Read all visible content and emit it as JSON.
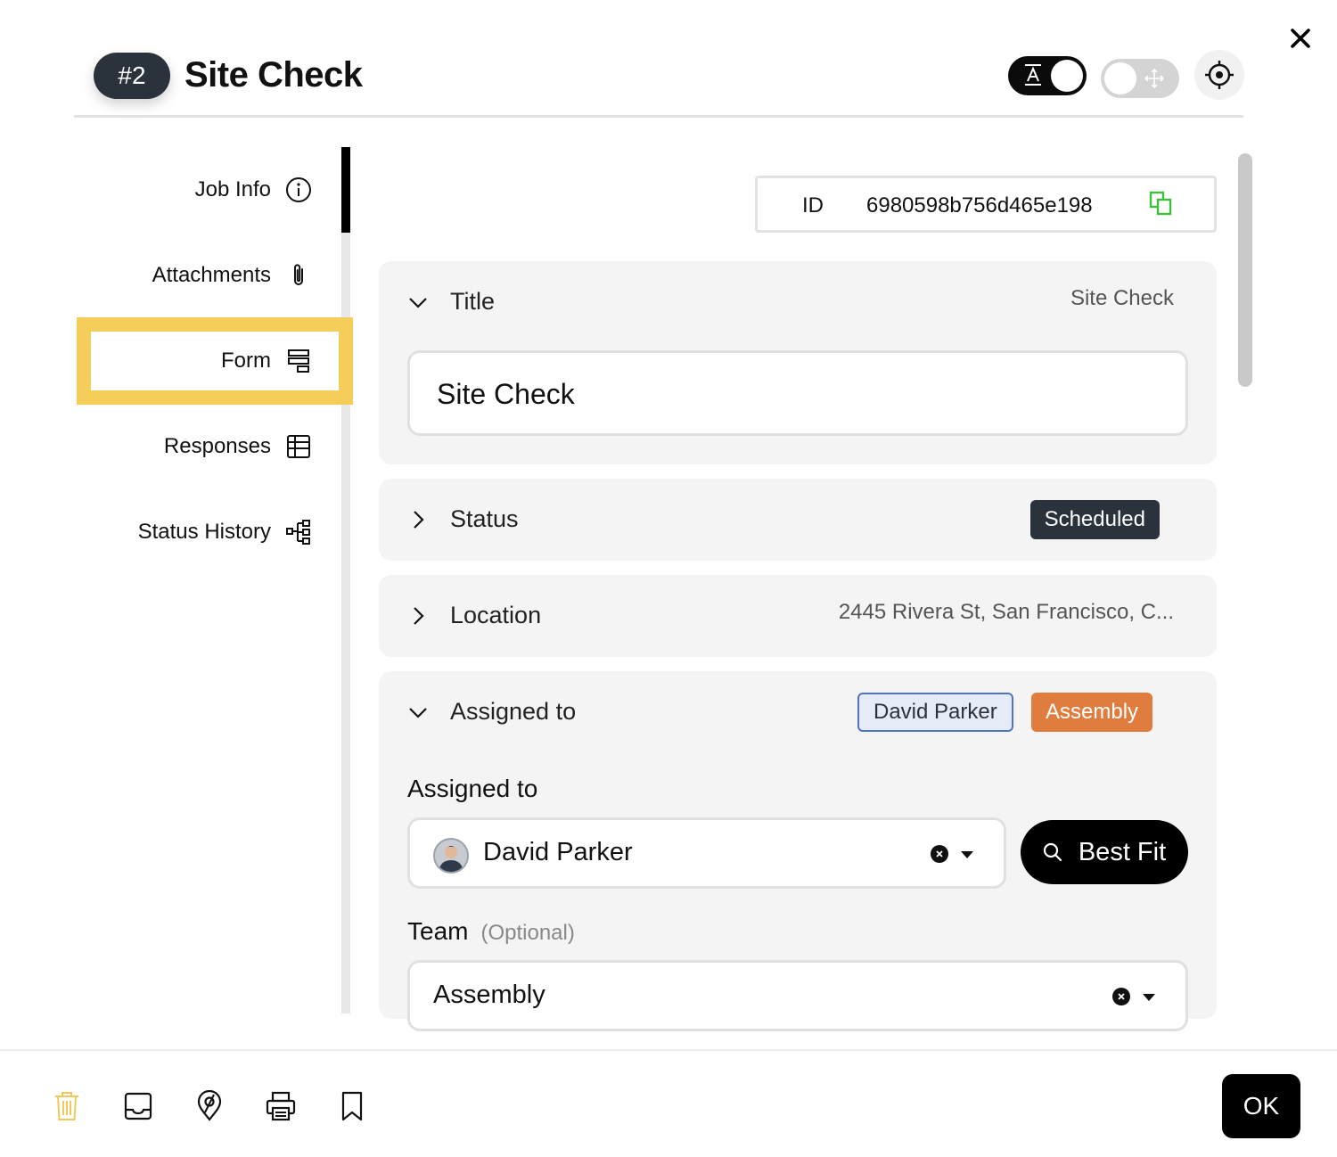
{
  "header": {
    "job_number": "#2",
    "job_title": "Site Check"
  },
  "sidebar": {
    "items": [
      {
        "label": "Job Info",
        "icon": "info-icon"
      },
      {
        "label": "Attachments",
        "icon": "paperclip-icon"
      },
      {
        "label": "Form",
        "icon": "form-icon",
        "highlighted": true
      },
      {
        "label": "Responses",
        "icon": "table-icon"
      },
      {
        "label": "Status History",
        "icon": "hierarchy-icon"
      }
    ]
  },
  "id_field": {
    "label": "ID",
    "value": "6980598b756d465e198"
  },
  "title_panel": {
    "label": "Title",
    "summary": "Site Check",
    "input_value": "Site Check",
    "expanded": true
  },
  "status_panel": {
    "label": "Status",
    "badge": "Scheduled",
    "expanded": false
  },
  "location_panel": {
    "label": "Location",
    "summary": "2445 Rivera St, San Francisco, C...",
    "expanded": false
  },
  "assigned_panel": {
    "label": "Assigned to",
    "chips": [
      "David Parker",
      "Assembly"
    ],
    "expanded": true,
    "assignee_label": "Assigned to",
    "assignee_value": "David Parker",
    "best_fit_label": "Best Fit",
    "team_label": "Team",
    "team_optional": "(Optional)",
    "team_value": "Assembly"
  },
  "footer": {
    "ok_label": "OK",
    "icons": [
      "trash-icon",
      "inbox-icon",
      "map-pin-icon",
      "printer-icon",
      "bookmark-icon"
    ]
  },
  "colors": {
    "highlight": "#f5cd5a",
    "badge_dark": "#2a323c",
    "team_chip": "#e07d3e",
    "person_chip_border": "#4f74c4",
    "copy_icon": "#3fbf3f",
    "trash_icon": "#f2c75c"
  }
}
